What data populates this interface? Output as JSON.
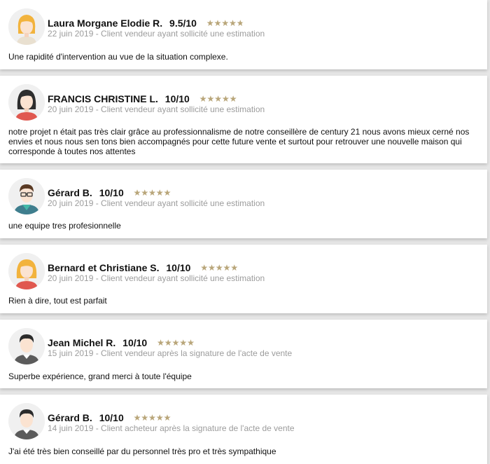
{
  "colors": {
    "star": "#b9a67a",
    "star_empty": "#ddd3bb",
    "meta": "#9c9c9c"
  },
  "reviews": [
    {
      "avatar": "woman-blonde-avatar-icon",
      "name": "Laura Morgane Elodie R.",
      "score": "9.5/10",
      "rating": 0.95,
      "meta": "22 juin 2019 - Client vendeur ayant sollicité une estimation",
      "comment": "Une rapidité d'intervention au vue de la situation complexe."
    },
    {
      "avatar": "woman-dark-hair-avatar-icon",
      "name": "FRANCIS CHRISTINE L.",
      "score": "10/10",
      "rating": 1,
      "meta": "20 juin 2019 - Client vendeur ayant sollicité une estimation",
      "comment": "notre projet n était pas très clair grâce au professionnalisme de notre conseillère de century 21 nous avons mieux cerné nos envies et nous nous sen tons bien accompagnés pour cette future vente et surtout pour retrouver une nouvelle maison qui corresponde à toutes nos attentes"
    },
    {
      "avatar": "man-glasses-avatar-icon",
      "name": "Gérard B.",
      "score": "10/10",
      "rating": 1,
      "meta": "20 juin 2019 - Client vendeur ayant sollicité une estimation",
      "comment": "une equipe tres profesionnelle"
    },
    {
      "avatar": "woman-blonde-avatar-icon",
      "name": "Bernard et Christiane S.",
      "score": "10/10",
      "rating": 1,
      "meta": "20 juin 2019 - Client vendeur ayant sollicité une estimation",
      "comment": "Rien à dire, tout est parfait"
    },
    {
      "avatar": "man-avatar-icon",
      "name": "Jean Michel R.",
      "score": "10/10",
      "rating": 1,
      "meta": "15 juin 2019 - Client vendeur après la signature de l'acte de vente",
      "comment": "Superbe expérience, grand merci à toute l'équipe"
    },
    {
      "avatar": "man-avatar-icon",
      "name": "Gérard B.",
      "score": "10/10",
      "rating": 1,
      "meta": "14 juin 2019 - Client acheteur après la signature de l'acte de vente",
      "comment": "J'ai été très bien conseillé par du personnel très pro et très sympathique"
    }
  ]
}
